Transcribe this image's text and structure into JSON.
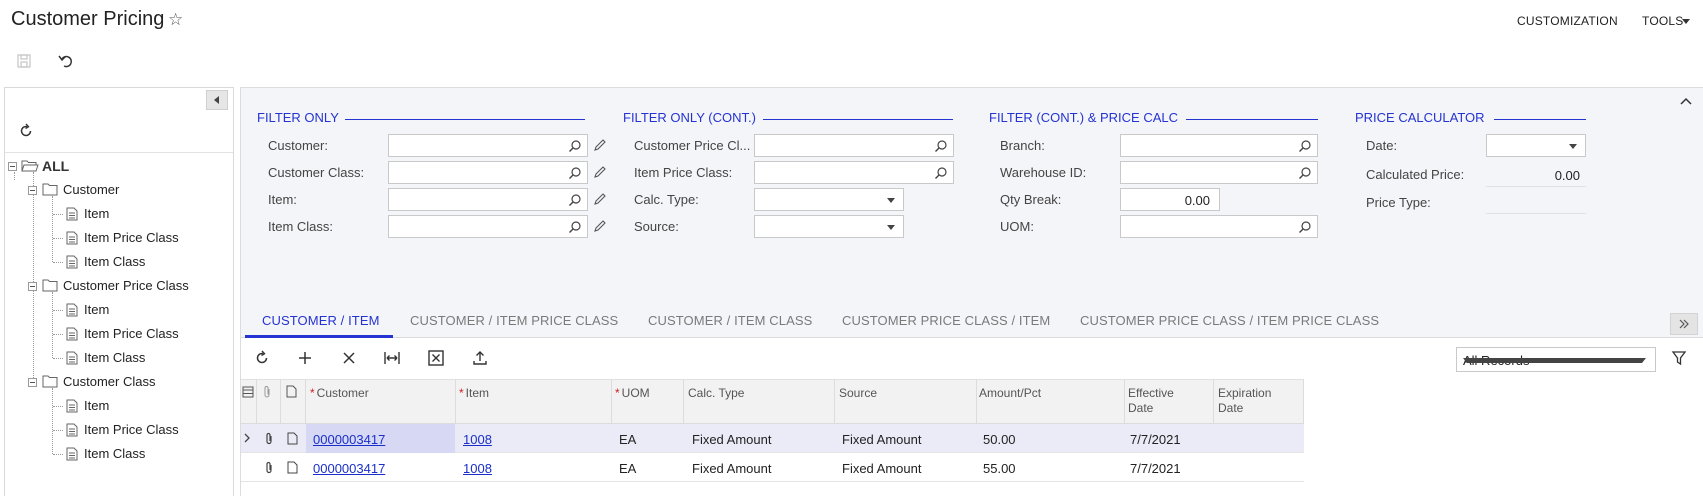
{
  "header": {
    "title": "Customer Pricing",
    "customization": "CUSTOMIZATION",
    "tools": "TOOLS"
  },
  "tree": {
    "root": "ALL",
    "groups": [
      {
        "label": "Customer",
        "children": [
          "Item",
          "Item Price Class",
          "Item Class"
        ]
      },
      {
        "label": "Customer Price Class",
        "children": [
          "Item",
          "Item Price Class",
          "Item Class"
        ]
      },
      {
        "label": "Customer Class",
        "children": [
          "Item",
          "Item Price Class",
          "Item Class"
        ]
      }
    ]
  },
  "filters": {
    "section1": {
      "title": "FILTER ONLY",
      "labels": [
        "Customer:",
        "Customer Class:",
        "Item:",
        "Item Class:"
      ]
    },
    "section2": {
      "title": "FILTER ONLY (CONT.)",
      "labels": [
        "Customer Price Cl...",
        "Item Price Class:",
        "Calc. Type:",
        "Source:"
      ]
    },
    "section3": {
      "title": "FILTER (CONT.) & PRICE CALC",
      "labels": [
        "Branch:",
        "Warehouse ID:",
        "Qty Break:",
        "UOM:"
      ],
      "qty_break_value": "0.00"
    },
    "section4": {
      "title": "PRICE CALCULATOR",
      "labels": [
        "Date:",
        "Calculated Price:",
        "Price Type:"
      ],
      "calculated_price": "0.00"
    }
  },
  "tabs": [
    "CUSTOMER / ITEM",
    "CUSTOMER / ITEM PRICE CLASS",
    "CUSTOMER / ITEM CLASS",
    "CUSTOMER PRICE CLASS / ITEM",
    "CUSTOMER PRICE CLASS / ITEM PRICE CLASS"
  ],
  "grid": {
    "records_filter": "All Records",
    "columns": {
      "customer": "Customer",
      "item": "Item",
      "uom": "UOM",
      "calc_type": "Calc. Type",
      "source": "Source",
      "amount": "Amount/Pct",
      "effective_1": "Effective",
      "effective_2": "Date",
      "expiration_1": "Expiration",
      "expiration_2": "Date"
    },
    "rows": [
      {
        "customer": "0000003417",
        "item": "1008",
        "uom": "EA",
        "calc_type": "Fixed Amount",
        "source": "Fixed Amount",
        "amount": "50.00",
        "effective": "7/7/2021",
        "expiration": ""
      },
      {
        "customer": "0000003417",
        "item": "1008",
        "uom": "EA",
        "calc_type": "Fixed Amount",
        "source": "Fixed Amount",
        "amount": "55.00",
        "effective": "7/7/2021",
        "expiration": ""
      }
    ]
  }
}
